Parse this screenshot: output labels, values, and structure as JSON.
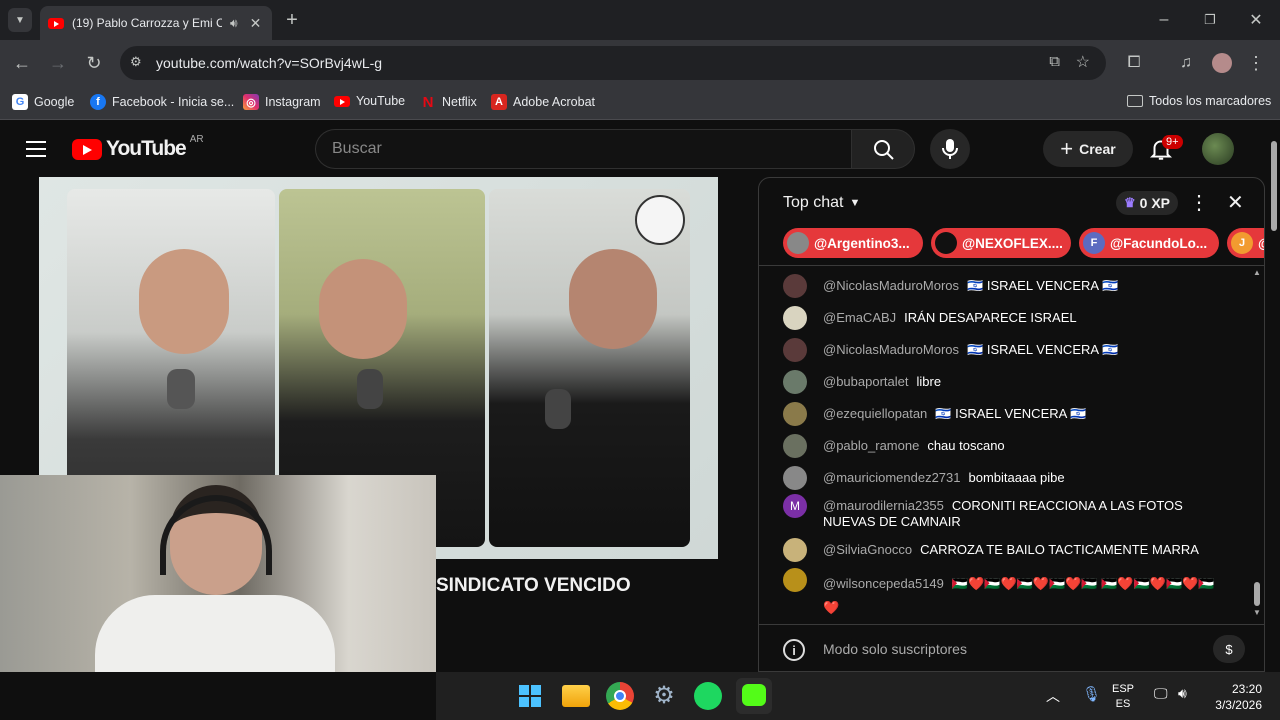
{
  "browser": {
    "tab": {
      "title": "(19) Pablo Carrozza y Emi C"
    },
    "new_tab": "+",
    "url": "youtube.com/watch?v=SOrBvj4wL-g",
    "bookmarks": [
      {
        "label": "Google",
        "icon": "google-icon",
        "color": "#4285f4"
      },
      {
        "label": "Facebook - Inicia se...",
        "icon": "facebook-icon",
        "color": "#1877f2"
      },
      {
        "label": "Instagram",
        "icon": "instagram-icon",
        "color": "#e1306c"
      },
      {
        "label": "YouTube",
        "icon": "youtube-icon",
        "color": "#ff0000"
      },
      {
        "label": "Netflix",
        "icon": "netflix-icon",
        "color": "#e50914"
      },
      {
        "label": "Adobe Acrobat",
        "icon": "acrobat-icon",
        "color": "#d8261f"
      }
    ],
    "all_bookmarks": "Todos los marcadores"
  },
  "youtube": {
    "logo_text": "YouTube",
    "region": "AR",
    "search_placeholder": "Buscar",
    "create_label": "Crear",
    "notifications": "9+",
    "video_title": "SINDICATO VENCIDO",
    "brand_color": "#ff0000"
  },
  "chat": {
    "mode": "Top chat",
    "xp": "0 XP",
    "donors": [
      {
        "name": "@Argentino3...",
        "color": "#e5383b"
      },
      {
        "name": "@NEXOFLEX....",
        "color": "#e5383b"
      },
      {
        "name": "@FacundoLo...",
        "color": "#e5383b",
        "initial": "F"
      },
      {
        "name": "@",
        "color": "#e5383b",
        "initial": "J"
      }
    ],
    "messages": [
      {
        "author": "@NicolasMaduroMoros",
        "text": "🇮🇱 ISRAEL VENCERA 🇮🇱",
        "avatar_color": "#5a3a3a"
      },
      {
        "author": "@EmaCABJ",
        "text": "IRÁN DESAPARECE ISRAEL",
        "avatar_color": "#d9d4c0"
      },
      {
        "author": "@NicolasMaduroMoros",
        "text": "🇮🇱 ISRAEL VENCERA 🇮🇱",
        "avatar_color": "#5a3a3a"
      },
      {
        "author": "@bubaportalet",
        "text": "libre",
        "avatar_color": "#6a7a6a"
      },
      {
        "author": "@ezequiellopatan",
        "text": "🇮🇱 ISRAEL VENCERA 🇮🇱",
        "avatar_color": "#8a7a4a"
      },
      {
        "author": "@pablo_ramone",
        "text": "chau toscano",
        "avatar_color": "#6a7060"
      },
      {
        "author": "@mauriciomendez2731",
        "text": "bombitaaaa pibe",
        "avatar_color": "#888888"
      },
      {
        "author": "@maurodilernia2355",
        "text": "CORONITI REACCIONA A LAS FOTOS NUEVAS DE CAMNAIR",
        "avatar_color": "#7b2fa6",
        "initial": "M"
      },
      {
        "author": "@SilviaGnocco",
        "text": "CARROZA TE BAILO TACTICAMENTE MARRA",
        "avatar_color": "#c8b27a"
      },
      {
        "author": "@wilsoncepeda5149",
        "text": "🇵🇸❤️🇵🇸❤️🇵🇸❤️🇵🇸❤️🇵🇸 🇵🇸❤️🇵🇸❤️🇵🇸❤️🇵🇸❤️",
        "avatar_color": "#b8901a"
      }
    ],
    "footer_text": "Modo solo suscriptores"
  },
  "taskbar": {
    "lang_top": "ESP",
    "lang_bottom": "ES",
    "time": "23:20",
    "date": "3/3/2026"
  }
}
